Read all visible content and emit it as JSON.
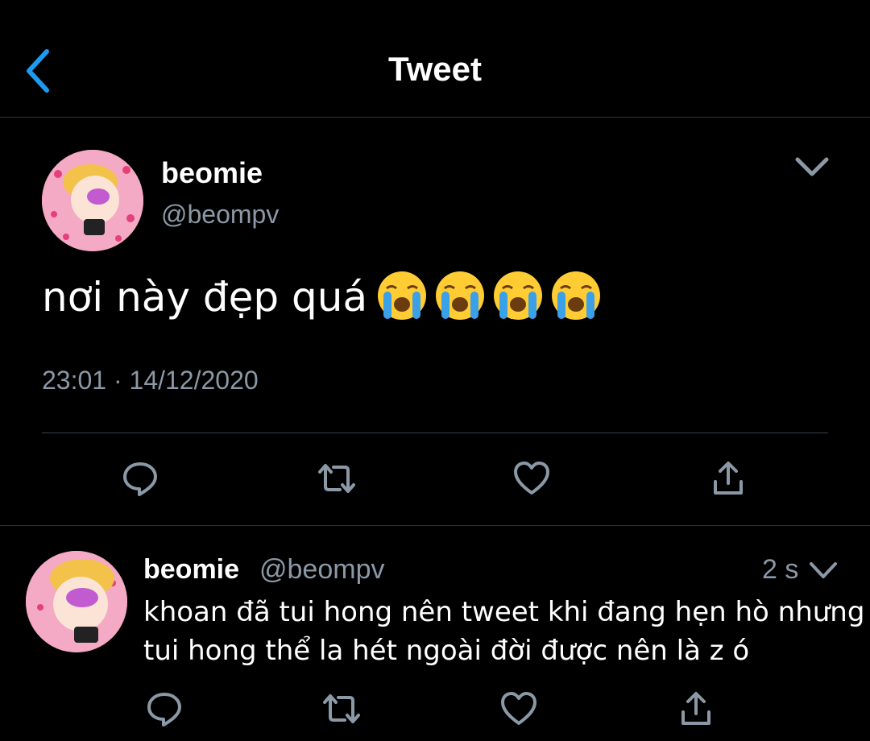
{
  "header": {
    "title": "Tweet",
    "back_icon": "chevron-left-icon",
    "accent": "#1d9bf0"
  },
  "main_tweet": {
    "name": "beomie",
    "handle": "@beompv",
    "text": "nơi này đẹp quá",
    "emojis": [
      "loudly-crying-face",
      "loudly-crying-face",
      "loudly-crying-face",
      "loudly-crying-face"
    ],
    "time": "23:01",
    "separator": "·",
    "date": "14/12/2020",
    "actions": [
      "reply-icon",
      "retweet-icon",
      "like-icon",
      "share-icon"
    ]
  },
  "reply": {
    "name": "beomie",
    "handle": "@beompv",
    "time_ago": "2 s",
    "text_line1": "khoan đã tui hong nên tweet khi đang hẹn hò nhưng",
    "text_line2": "tui hong thể la hét ngoài đời được nên là z ó",
    "actions": [
      "reply-icon",
      "retweet-icon",
      "like-icon",
      "share-icon"
    ]
  },
  "colors": {
    "background": "#000000",
    "text": "#ffffff",
    "muted": "#8b98a5",
    "divider": "#38444d",
    "avatar": "#f4a9c4"
  }
}
